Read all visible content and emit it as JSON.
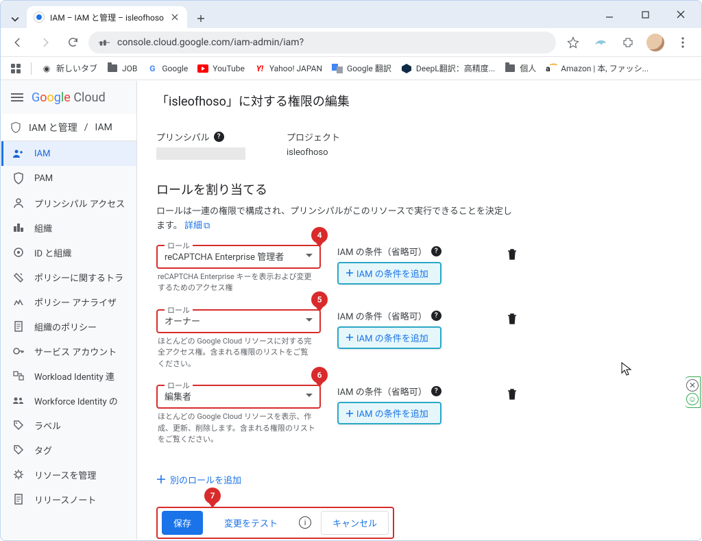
{
  "browser": {
    "tab_title": "IAM – IAM と管理 – isleofhoso",
    "url": "console.cloud.google.com/iam-admin/iam?"
  },
  "bookmarks": [
    "新しいタブ",
    "JOB",
    "Google",
    "YouTube",
    "Yahoo! JAPAN",
    "Google 翻訳",
    "DeepL翻訳：高精度...",
    "個人",
    "Amazon | 本, ファッシ..."
  ],
  "gcp_brand": "Google Cloud",
  "breadcrumb": {
    "product": "IAM と管理",
    "page": "IAM"
  },
  "sidebar": [
    {
      "label": "IAM",
      "active": true
    },
    {
      "label": "PAM"
    },
    {
      "label": "プリンシパル アクセス"
    },
    {
      "label": "組織"
    },
    {
      "label": "ID と組織"
    },
    {
      "label": "ポリシーに関するトラ"
    },
    {
      "label": "ポリシー アナライザ"
    },
    {
      "label": "組織のポリシー"
    },
    {
      "label": "サービス アカウント"
    },
    {
      "label": "Workload Identity 連"
    },
    {
      "label": "Workforce Identity の"
    },
    {
      "label": "ラベル"
    },
    {
      "label": "タグ"
    },
    {
      "label": "リソースを管理"
    },
    {
      "label": "リリースノート"
    }
  ],
  "page": {
    "title": "「isleofhoso」に対する権限の編集",
    "principal_label": "プリンシパル",
    "project_label": "プロジェクト",
    "project_value": "isleofhoso",
    "assign_title": "ロールを割り当てる",
    "assign_desc": "ロールは一連の権限で構成され、プリンシパルがこのリソースで実行できることを決定します。",
    "details_link": "詳細",
    "role_field_label": "ロール",
    "cond_label": "IAM の条件（省略可）",
    "cond_button": "IAM の条件を追加",
    "add_role": "別のロールを追加",
    "roles": [
      {
        "value": "reCAPTCHA Enterprise 管理者",
        "desc": "reCAPTCHA Enterprise キーを表示および変更するためのアクセス権",
        "callout": "4"
      },
      {
        "value": "オーナー",
        "desc": "ほとんどの Google Cloud リソースに対する完全アクセス権。含まれる権限のリストをご覧ください。",
        "callout": "5"
      },
      {
        "value": "編集者",
        "desc": "ほとんどの Google Cloud リソースを表示、作成、更新、削除します。含まれる権限のリストをご覧ください。",
        "callout": "6"
      }
    ],
    "actions": {
      "save": "保存",
      "test": "変更をテスト",
      "cancel": "キャンセル",
      "callout": "7"
    }
  }
}
